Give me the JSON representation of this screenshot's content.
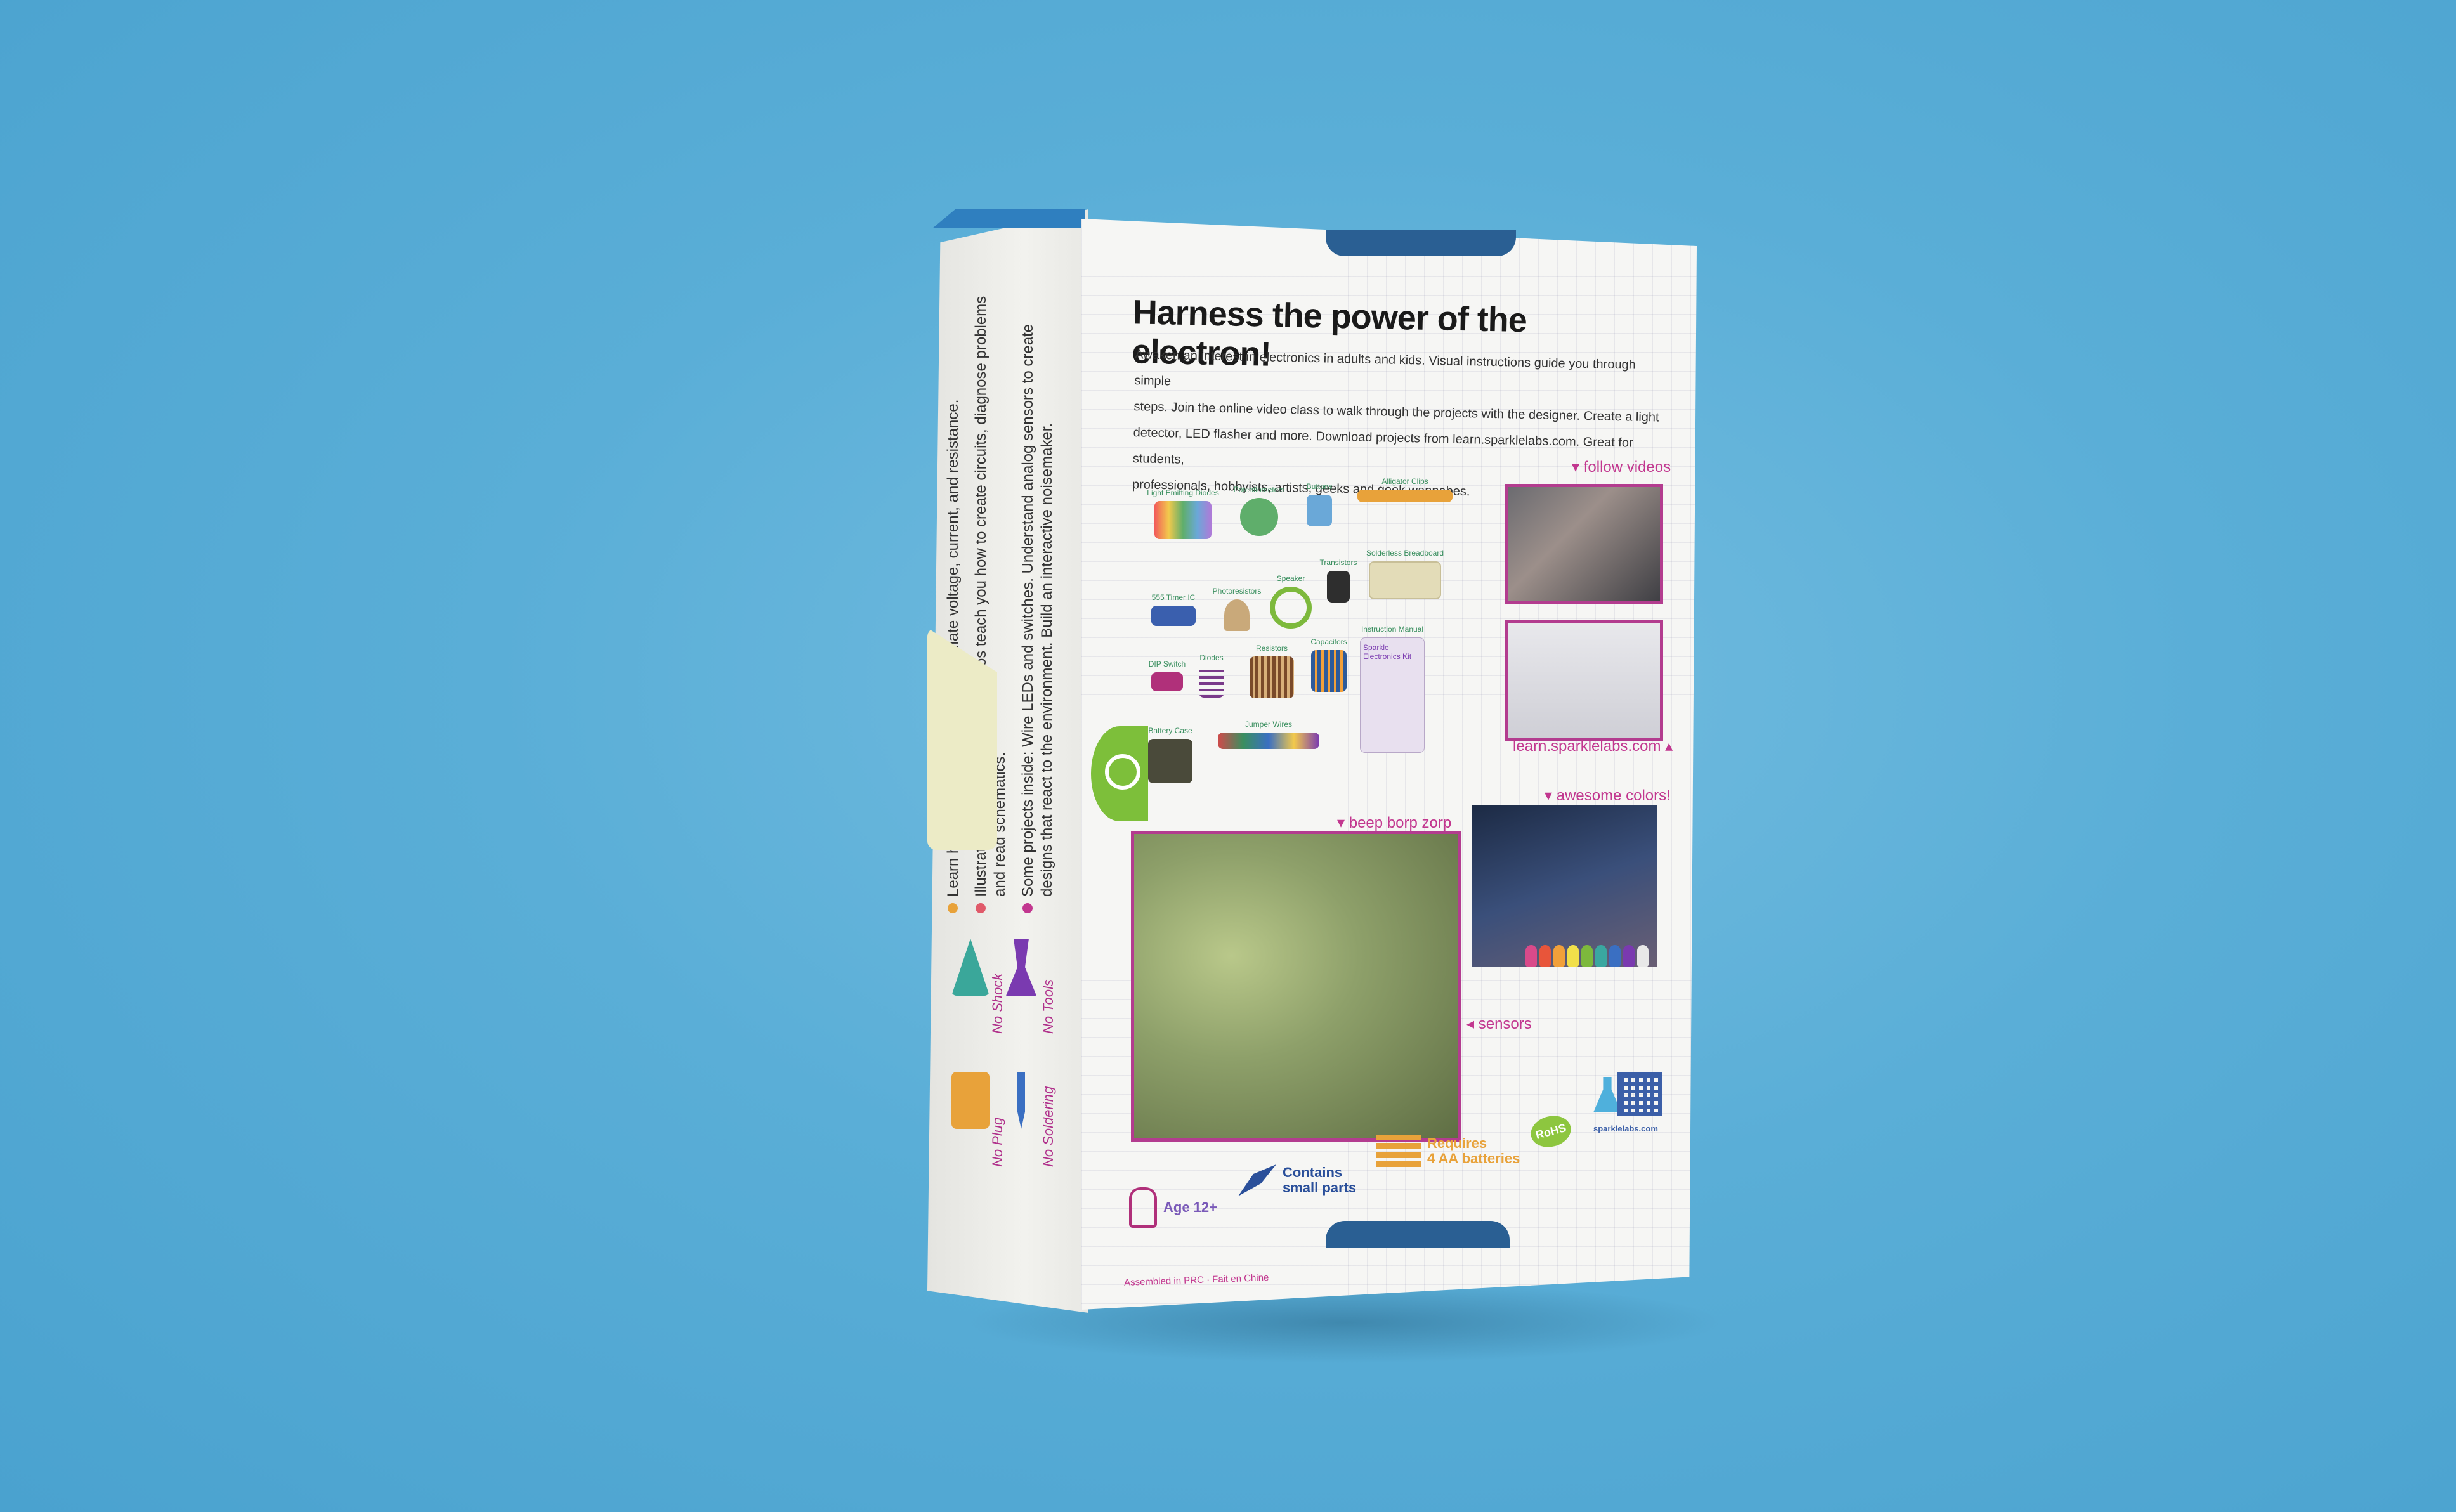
{
  "front": {
    "headline": "Harness the power of the electron!",
    "intro_lines": [
      "Awaken an interest in electronics in adults and kids. Visual instructions guide you through simple",
      "steps. Join the online video class to walk through the projects with the designer. Create a light",
      "detector, LED flasher and more. Download projects from learn.sparklelabs.com. Great for students,",
      "professionals, hobbyists, artists, geeks and geek wannabes."
    ],
    "parts": [
      {
        "label": "Light Emitting Diodes",
        "color": "#f2c94c"
      },
      {
        "label": "Potentiometers",
        "color": "#5fae6b"
      },
      {
        "label": "Buttons",
        "color": "#6aa8d8"
      },
      {
        "label": "Alligator Clips",
        "color": "#e8a23a"
      },
      {
        "label": "555 Timer IC",
        "color": "#3a5fae"
      },
      {
        "label": "Photoresistors",
        "color": "#c9a97a"
      },
      {
        "label": "Speaker",
        "color": "#7db93c"
      },
      {
        "label": "Transistors",
        "color": "#2e2e2e"
      },
      {
        "label": "Solderless Breadboard",
        "color": "#e3dcb8"
      },
      {
        "label": "DIP Switch",
        "color": "#b0307a"
      },
      {
        "label": "Diodes",
        "color": "#7a3a8a"
      },
      {
        "label": "Resistors",
        "color": "#7a4a2a"
      },
      {
        "label": "Capacitors",
        "color": "#2d5a9a"
      },
      {
        "label": "Instruction Manual",
        "color": "#e8e0ef"
      },
      {
        "label": "Battery Case",
        "color": "#4a4a3a"
      },
      {
        "label": "Jumper Wires",
        "color": "#d04a4a"
      }
    ],
    "manual_cover": "Sparkle Electronics Kit",
    "captions": {
      "follow_videos": "▾ follow videos",
      "learn_url": "learn.sparklelabs.com ▴",
      "beep": "▾ beep borp zorp",
      "awesome_colors": "▾ awesome colors!",
      "sensors": "◂ sensors"
    },
    "bottom": {
      "age": "Age 12+",
      "small_parts_1": "Contains",
      "small_parts_2": "small parts",
      "batteries_1": "Requires",
      "batteries_2": "4 AA batteries",
      "rohs": "RoHS",
      "brand": "sparklelabs.com",
      "assembled": "Assembled in PRC · Fait en Chine"
    }
  },
  "side": {
    "bullets": [
      {
        "text": "Learn how electricity works and calculate voltage, current, and resistance.",
        "color": "#e8a23a"
      },
      {
        "text": "Illustrated projects and online videos teach you how to create circuits, diagnose problems and read schematics.",
        "color": "#e05a6a"
      },
      {
        "text": "Some projects inside: Wire LEDs and switches. Understand analog sensors to create designs that react to the environment. Build an interactive noisemaker.",
        "color": "#c2378f"
      }
    ],
    "icons": [
      {
        "label": "No Shock",
        "color": "#3aa79a"
      },
      {
        "label": "No Tools",
        "color": "#7a3ab0"
      },
      {
        "label": "No Plug",
        "color": "#e8a23a"
      },
      {
        "label": "No Soldering",
        "color": "#3a6fc2"
      }
    ]
  },
  "colors": {
    "background": "#5aaed7",
    "accent_pink": "#c2378f",
    "accent_green": "#7dbf3a",
    "box_blue": "#2a5f93"
  }
}
